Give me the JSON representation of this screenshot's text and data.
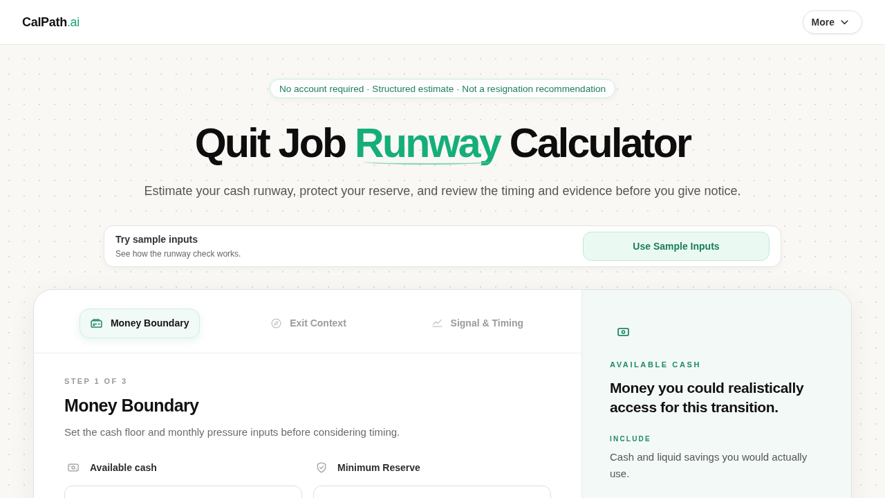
{
  "header": {
    "logo": {
      "name": "CalPath",
      "suffix": ".ai"
    },
    "menu_button": "More"
  },
  "hero": {
    "badge": "No account required · Structured estimate · Not a resignation recommendation",
    "title": "Quit Job **Runway** Calculator",
    "subtitle": "Estimate your cash runway, protect your reserve, and review the timing and evidence before you give notice."
  },
  "sample_card": {
    "title": "Try sample inputs",
    "description": "See how the runway check works.",
    "button": "Use Sample Inputs"
  },
  "wizard": {
    "tabs": [
      {
        "label": "Money Boundary",
        "selected": true
      },
      {
        "label": "Exit Context",
        "selected": false
      },
      {
        "label": "Signal & Timing",
        "selected": false
      }
    ],
    "step": {
      "counter": "STEP 1 OF 3",
      "title": "Money Boundary",
      "description": "Set the cash floor and monthly pressure inputs before considering timing."
    },
    "fields": [
      {
        "label": "Available cash"
      },
      {
        "label": "Minimum Reserve"
      }
    ]
  },
  "info_panel": {
    "eyebrow": "AVAILABLE CASH",
    "heading": "Money you could realistically access for this transition.",
    "section_label": "INCLUDE",
    "text": "Cash and liquid savings you would actually use."
  }
}
